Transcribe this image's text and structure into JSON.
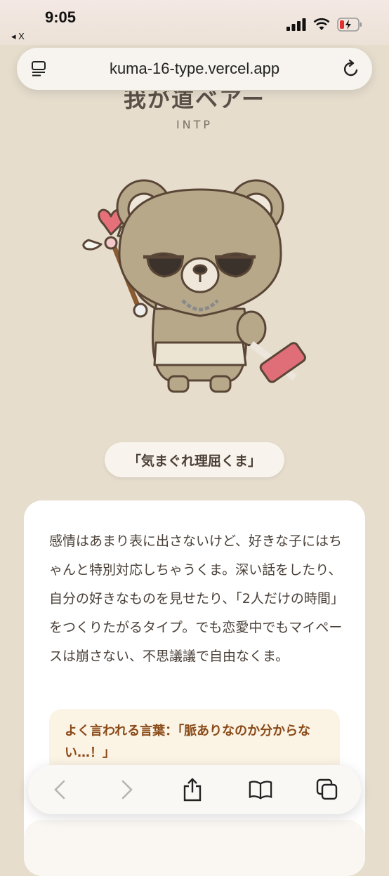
{
  "status": {
    "time": "9:05",
    "back_app": "◂ X"
  },
  "browser": {
    "url": "kuma-16-type.vercel.app"
  },
  "result": {
    "type_name": "我が道ベアー",
    "type_code": "INTP",
    "nickname": "「気まぐれ理屈くま」",
    "description": "感情はあまり表に出さないけど、好きな子にはちゃんと特別対応しちゃうくま。深い話をしたり、自分の好きなものを見せたり、「2人だけの時間」をつくりたがるタイプ。でも恋愛中でもマイペースは崩さない、不思議議で自由なくま。",
    "quote": "よく言われる言葉：「脈ありなのか分からない…！」"
  },
  "colors": {
    "background": "#e6ddcd",
    "card": "#ffffff",
    "quote_bg": "#fbf3e4",
    "quote_text": "#8a4a18"
  }
}
